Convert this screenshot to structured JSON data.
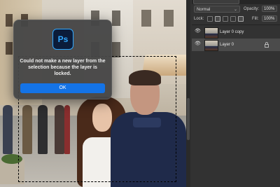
{
  "dialog": {
    "app_icon_label": "Ps",
    "message": "Could not make a new layer from the selection because the layer is locked.",
    "ok_label": "OK"
  },
  "layers_panel": {
    "blend_mode": "Normal",
    "opacity_label": "Opacity:",
    "opacity_value": "100%",
    "lock_label": "Lock:",
    "fill_label": "Fill:",
    "fill_value": "100%",
    "layers": [
      {
        "name": "Layer 0 copy",
        "visible": true,
        "selected": false,
        "locked": false
      },
      {
        "name": "Layer 0",
        "visible": true,
        "selected": true,
        "locked": true
      }
    ]
  },
  "colors": {
    "accent": "#1473e6",
    "panel_bg": "#323232",
    "dialog_bg": "#464646",
    "ps_icon": "#31a8ff"
  }
}
